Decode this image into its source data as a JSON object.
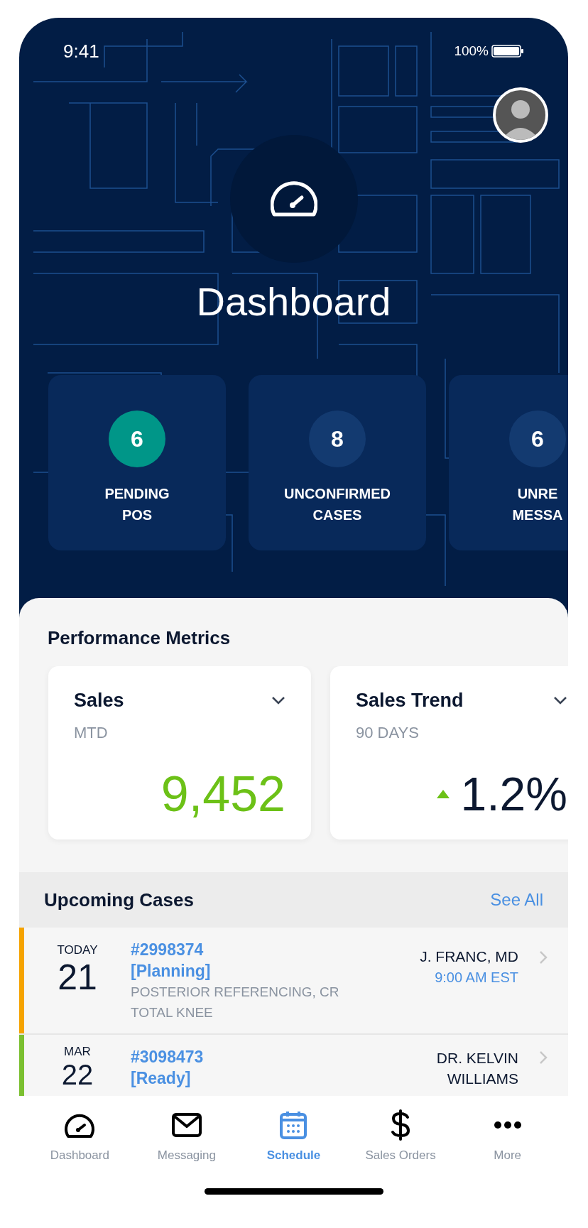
{
  "status_bar": {
    "time": "9:41",
    "battery": "100%"
  },
  "header": {
    "title": "Dashboard"
  },
  "stat_cards": [
    {
      "count": "6",
      "label_lines": [
        "PENDING",
        "POS"
      ],
      "color": "#009688"
    },
    {
      "count": "8",
      "label_lines": [
        "UNCONFIRMED",
        "CASES"
      ],
      "color": "#133a70"
    },
    {
      "count": "6",
      "label_lines": [
        "UNRE",
        "MESSA"
      ],
      "color": "#133a70"
    }
  ],
  "performance_metrics": {
    "title": "Performance Metrics",
    "cards": [
      {
        "kind": "count",
        "title": "Sales",
        "period": "MTD",
        "value": "9,452"
      },
      {
        "kind": "trend",
        "title": "Sales Trend",
        "period": "90 DAYS",
        "value": "1.2%"
      }
    ]
  },
  "upcoming_cases": {
    "title": "Upcoming Cases",
    "link": "See All",
    "rows": [
      {
        "color": "#f5a300",
        "day_label": "TODAY",
        "day": "21",
        "case_number": "#2998374",
        "status": "[Planning]",
        "description": "POSTERIOR REFERENCING, CR TOTAL KNEE",
        "surgeon": "J. FRANC, MD",
        "time": "9:00 AM EST"
      },
      {
        "color": "#7bc030",
        "day_label": "MAR",
        "day": "22",
        "case_number": "#3098473",
        "status": "[Ready]",
        "surgeon": "DR. KELVIN WILLIAMS"
      }
    ]
  },
  "tab_bar": [
    {
      "kind": "gauge",
      "label": "Dashboard",
      "selected": false
    },
    {
      "kind": "mail",
      "label": "Messaging",
      "selected": false
    },
    {
      "kind": "calendar",
      "label": "Schedule",
      "selected": true
    },
    {
      "kind": "dollar",
      "label": "Sales Orders",
      "selected": false
    },
    {
      "kind": "more",
      "label": "More",
      "selected": false
    }
  ]
}
